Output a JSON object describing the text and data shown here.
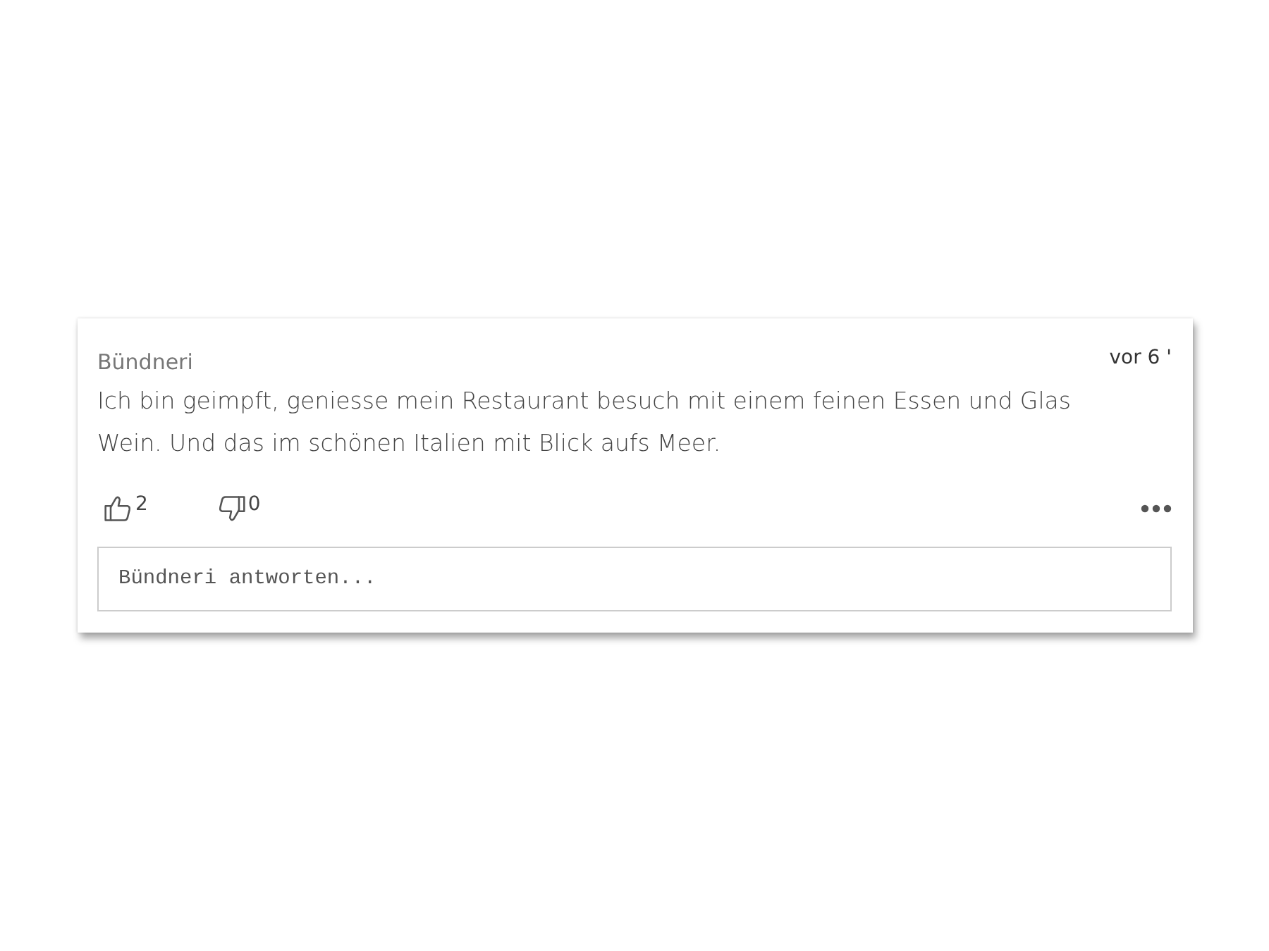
{
  "comment": {
    "author": "Bündneri",
    "time": "vor 6 '",
    "text": "Ich bin geimpft, geniesse mein Restaurant besuch mit einem feinen Essen und Glas Wein. Und das im schönen Italien mit Blick aufs Meer.",
    "likes": "2",
    "dislikes": "0"
  },
  "reply": {
    "placeholder": "Bündneri antworten..."
  }
}
